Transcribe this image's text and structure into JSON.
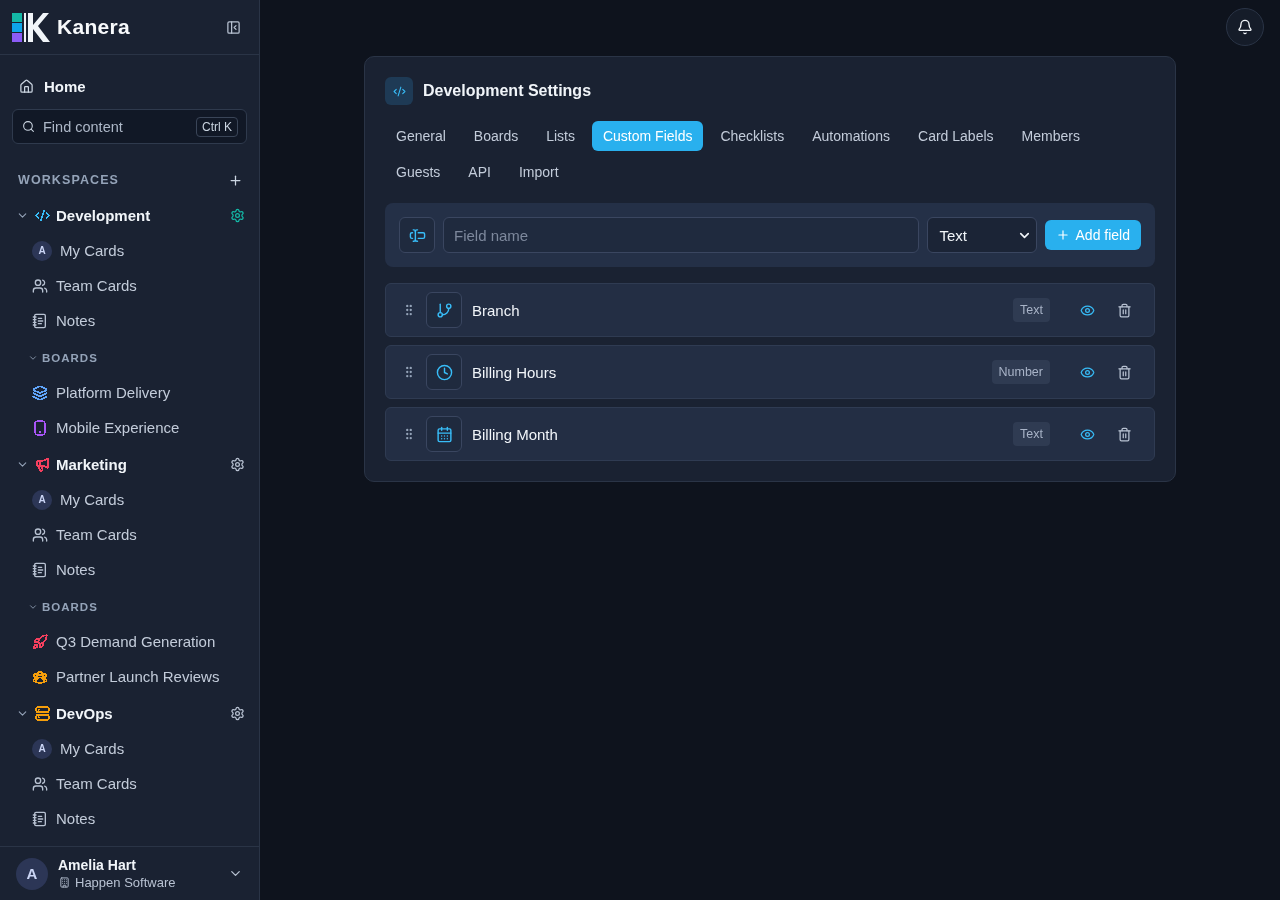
{
  "sidebar": {
    "logo": "Kanera",
    "home": "Home",
    "search": {
      "placeholder": "Find content",
      "shortcut": "Ctrl K"
    },
    "section_title": "WORKSPACES",
    "workspaces": [
      {
        "name": "Development",
        "kind": "code",
        "color": "#38bdf8",
        "selected": true,
        "expanded": true,
        "items": [
          {
            "kind": "mine",
            "label": "My Cards",
            "avatar": "A"
          },
          {
            "kind": "team",
            "label": "Team Cards"
          },
          {
            "kind": "notes",
            "label": "Notes"
          }
        ],
        "boards": {
          "title": "BOARDS",
          "expanded": true,
          "items": [
            {
              "name": "Platform Delivery",
              "kind": "layers",
              "color": "#60a5fa"
            },
            {
              "name": "Mobile Experience",
              "kind": "phone",
              "color": "#a855f7"
            }
          ]
        }
      },
      {
        "name": "Marketing",
        "kind": "megaphone",
        "color": "#f43f5e",
        "selected": false,
        "expanded": true,
        "items": [
          {
            "kind": "mine",
            "label": "My Cards",
            "avatar": "A"
          },
          {
            "kind": "team",
            "label": "Team Cards"
          },
          {
            "kind": "notes",
            "label": "Notes"
          }
        ],
        "boards": {
          "title": "BOARDS",
          "expanded": true,
          "items": [
            {
              "name": "Q3 Demand Generation",
              "kind": "rocket",
              "color": "#f43f5e"
            },
            {
              "name": "Partner Launch Reviews",
              "kind": "group",
              "color": "#f59e0b"
            }
          ]
        }
      },
      {
        "name": "DevOps",
        "kind": "server",
        "color": "#f59e0b",
        "selected": false,
        "expanded": true,
        "items": [
          {
            "kind": "mine",
            "label": "My Cards",
            "avatar": "A"
          },
          {
            "kind": "team",
            "label": "Team Cards"
          },
          {
            "kind": "notes",
            "label": "Notes"
          }
        ]
      }
    ],
    "user": {
      "avatar": "A",
      "name": "Amelia Hart",
      "organization": "Happen Software"
    }
  },
  "settings": {
    "title": "Development Settings",
    "tabs": [
      {
        "label": "General",
        "selected": false
      },
      {
        "label": "Boards",
        "selected": false
      },
      {
        "label": "Lists",
        "selected": false
      },
      {
        "label": "Custom Fields",
        "selected": true
      },
      {
        "label": "Checklists",
        "selected": false
      },
      {
        "label": "Automations",
        "selected": false
      },
      {
        "label": "Card Labels",
        "selected": false
      },
      {
        "label": "Members",
        "selected": false
      },
      {
        "label": "Guests",
        "selected": false
      },
      {
        "label": "API",
        "selected": false
      },
      {
        "label": "Import",
        "selected": false
      }
    ],
    "new_field": {
      "placeholder": "Field name",
      "type": "Text",
      "button": "Add field"
    },
    "fields": [
      {
        "name": "Branch",
        "kind": "branch",
        "type": "Text",
        "visible": true
      },
      {
        "name": "Billing Hours",
        "kind": "clock",
        "type": "Number",
        "visible": true
      },
      {
        "name": "Billing Month",
        "kind": "calendar",
        "type": "Text",
        "visible": true
      }
    ]
  }
}
